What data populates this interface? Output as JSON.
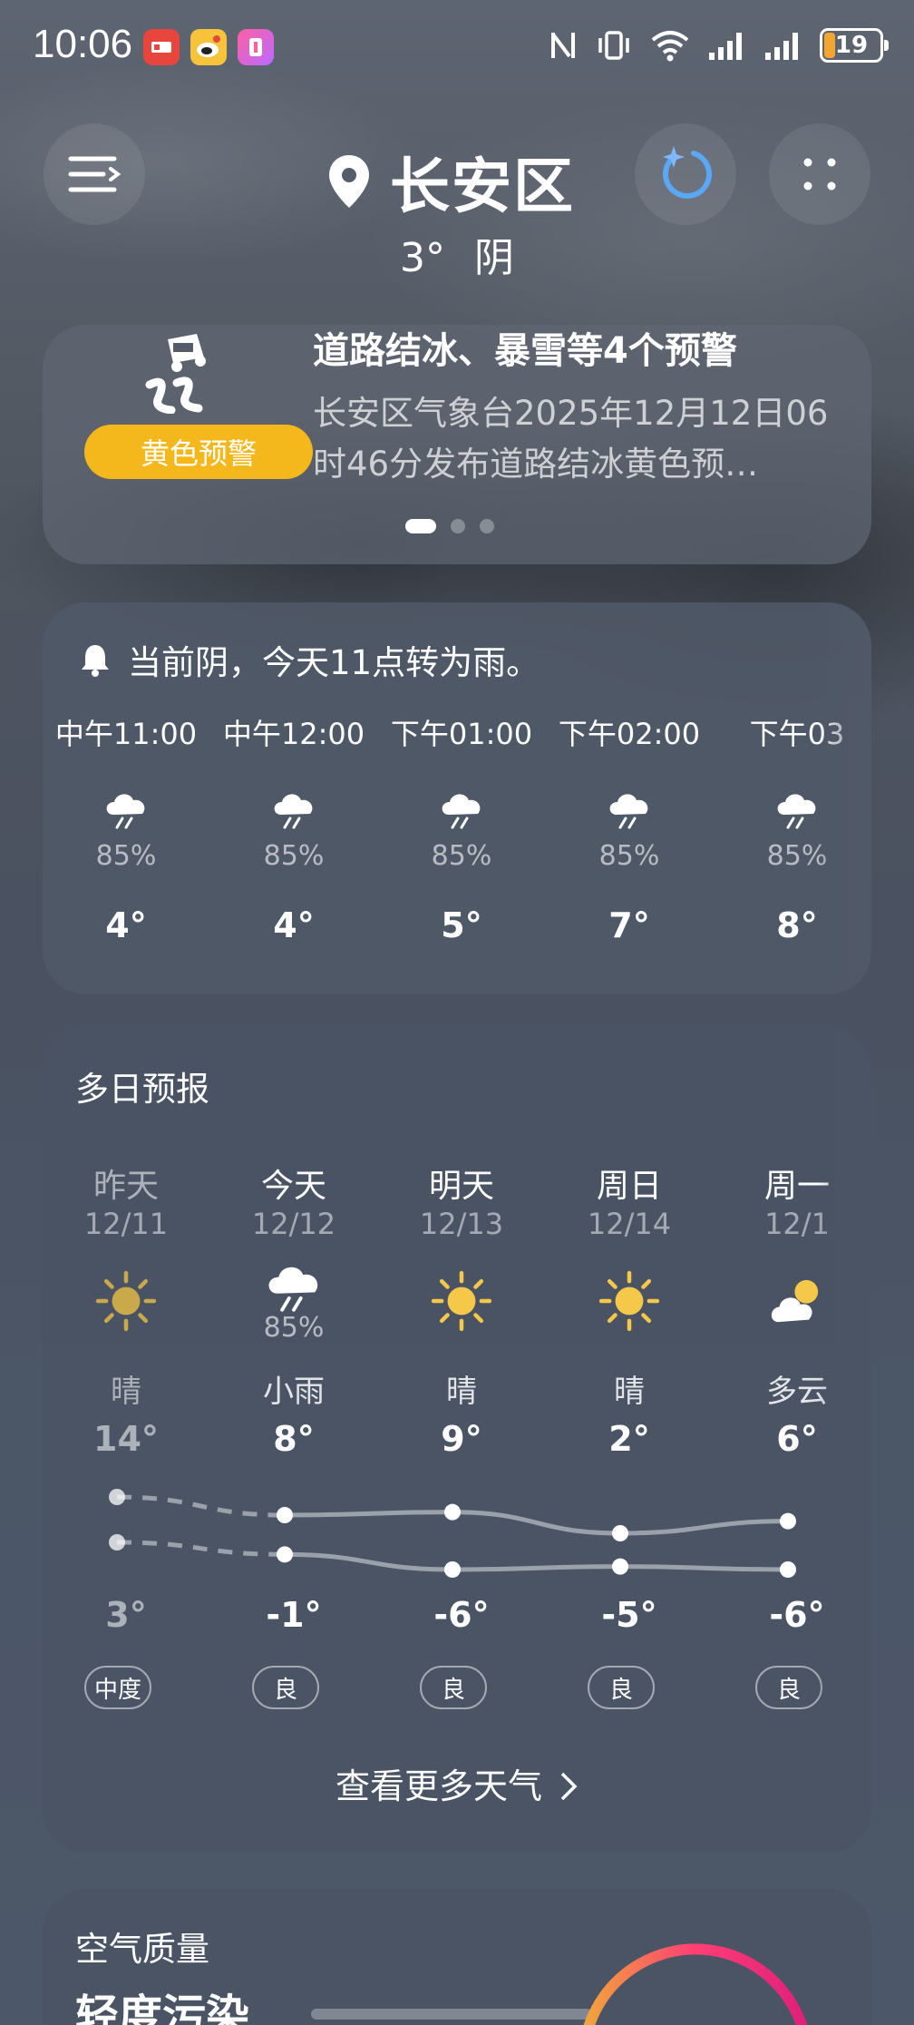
{
  "status": {
    "time": "10:06",
    "battery": "19"
  },
  "header": {
    "location": "长安区",
    "current_temp": "3°",
    "current_condition": "阴"
  },
  "alert": {
    "title": "道路结冰、暴雪等4个预警",
    "body": "长安区气象台2025年12月12日06时46分发布道路结冰黄色预…",
    "badge": "黄色预警",
    "badge_color": "#f5b81c",
    "page_count": 3,
    "active_page": 1
  },
  "hourly": {
    "summary": "当前阴，今天11点转为雨。",
    "items": [
      {
        "time": "中午11:00",
        "icon": "rain-cloud-icon",
        "precip": "85%",
        "temp": "4°"
      },
      {
        "time": "中午12:00",
        "icon": "rain-cloud-icon",
        "precip": "85%",
        "temp": "4°"
      },
      {
        "time": "下午01:00",
        "icon": "rain-cloud-icon",
        "precip": "85%",
        "temp": "5°"
      },
      {
        "time": "下午02:00",
        "icon": "rain-cloud-icon",
        "precip": "85%",
        "temp": "7°"
      },
      {
        "time": "下午03",
        "icon": "rain-cloud-icon",
        "precip": "85%",
        "temp": "8°"
      }
    ]
  },
  "daily": {
    "title": "多日预报",
    "more_label": "查看更多天气",
    "days": [
      {
        "name": "昨天",
        "date": "12/11",
        "icon": "sun-icon",
        "precip": "",
        "condition": "晴",
        "high": "14°",
        "low": "3°",
        "aqi": "中度",
        "high_value": 14,
        "low_value": 3
      },
      {
        "name": "今天",
        "date": "12/12",
        "icon": "rain-cloud-icon",
        "precip": "85%",
        "condition": "小雨",
        "high": "8°",
        "low": "-1°",
        "aqi": "良",
        "high_value": 8,
        "low_value": -1
      },
      {
        "name": "明天",
        "date": "12/13",
        "icon": "sun-icon",
        "precip": "",
        "condition": "晴",
        "high": "9°",
        "low": "-6°",
        "aqi": "良",
        "high_value": 9,
        "low_value": -6
      },
      {
        "name": "周日",
        "date": "12/14",
        "icon": "sun-icon",
        "precip": "",
        "condition": "晴",
        "high": "2°",
        "low": "-5°",
        "aqi": "良",
        "high_value": 2,
        "low_value": -5
      },
      {
        "name": "周一",
        "date": "12/1",
        "icon": "partly-cloudy-icon",
        "precip": "",
        "condition": "多云",
        "high": "6°",
        "low": "-6°",
        "aqi": "良",
        "high_value": 6,
        "low_value": -6
      }
    ]
  },
  "air_quality": {
    "title": "空气质量",
    "level": "轻度污染"
  }
}
